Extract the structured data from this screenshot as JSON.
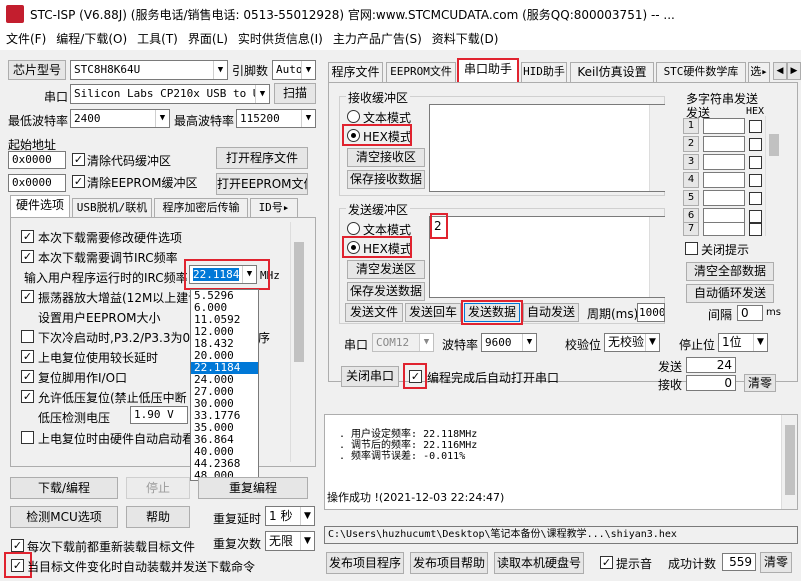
{
  "title": "STC-ISP (V6.88J) (服务电话/销售电话: 0513-55012928) 官网:www.STCMCUDATA.com  (服务QQ:800003751) -- ...",
  "menu": [
    "文件(F)",
    "编程/下载(O)",
    "工具(T)",
    "界面(L)",
    "实时供货信息(I)",
    "主力产品广告(S)",
    "资料下载(D)"
  ],
  "left": {
    "chip_label": "芯片型号",
    "chip_value": "STC8H8K64U",
    "pins_label": "引脚数",
    "pins_value": "Auto",
    "port_label": "串口",
    "port_value": "Silicon Labs CP210x USB to UA",
    "scan": "扫描",
    "min_baud_label": "最低波特率",
    "min_baud": "2400",
    "max_baud_label": "最高波特率",
    "max_baud": "115200",
    "start_addr_label": "起始地址",
    "addr1": "0x0000",
    "clear_code": "清除代码缓冲区",
    "open_prog": "打开程序文件",
    "addr2": "0x0000",
    "clear_eeprom": "清除EEPROM缓冲区",
    "open_eeprom": "打开EEPROM文件",
    "tabs": [
      "硬件选项",
      "USB脱机/联机",
      "程序加密后传输",
      "ID号▸"
    ],
    "opts": [
      "本次下载需要修改硬件选项",
      "本次下载需要调节IRC频率",
      "输入用户程序运行时的IRC频率",
      "振荡器放大增益(12M以上建议",
      "设置用户EEPROM大小",
      "下次冷启动时,P3.2/P3.3为0/0",
      "上电复位使用较长延时",
      "复位脚用作I/O口",
      "允许低压复位(禁止低压中断",
      "低压检测电压",
      "上电复位时由硬件自动启动看"
    ],
    "irc_value": "22.1184",
    "irc_unit": "MHz",
    "lv_value": "1.90 V",
    "opt_tail": "序",
    "freq_list": [
      "5.5296",
      "6.000",
      "11.0592",
      "12.000",
      "18.432",
      "20.000",
      "22.1184",
      "24.000",
      "27.000",
      "30.000",
      "33.1776",
      "35.000",
      "36.864",
      "40.000",
      "44.2368",
      "48.000"
    ],
    "download": "下载/编程",
    "stop": "停止",
    "reprogram": "重复编程",
    "detect": "检测MCU选项",
    "help": "帮助",
    "delay_label": "重复延时",
    "delay_value": "1 秒",
    "count_label": "重复次数",
    "count_value": "无限",
    "reload": "每次下载前都重新装载目标文件",
    "auto_reload": "当目标文件变化时自动装载并发送下载命令"
  },
  "right": {
    "tabs": [
      "程序文件",
      "EEPROM文件",
      "串口助手",
      "HID助手",
      "Keil仿真设置",
      "STC硬件数学库",
      "选▸"
    ],
    "rx_group": "接收缓冲区",
    "text_mode": "文本模式",
    "hex_mode": "HEX模式",
    "clear_rx": "清空接收区",
    "save_rx": "保存接收数据",
    "tx_group": "发送缓冲区",
    "clear_tx": "清空发送区",
    "save_tx": "保存发送数据",
    "tx_value": "2",
    "send_file": "发送文件",
    "send_return": "发送回车",
    "send_data": "发送数据",
    "auto_send": "自动发送",
    "period_label": "周期(ms)",
    "period": "1000",
    "multi_title": "多字符串发送",
    "col_send": "发送",
    "col_hex": "HEX",
    "multi_rows": [
      "1",
      "2",
      "3",
      "4",
      "5",
      "6",
      "7"
    ],
    "close_hint": "关闭提示",
    "clear_all": "清空全部数据",
    "auto_loop": "自动循环发送",
    "interval_label": "间隔",
    "interval": "0",
    "interval_unit": "ms",
    "serial_label": "串口",
    "serial_value": "COM12",
    "baud_label": "波特率",
    "baud_value": "9600",
    "parity_label": "校验位",
    "parity_value": "无校验",
    "stop_label": "停止位",
    "stop_value": "1位",
    "close_port": "关闭串口",
    "auto_open": "编程完成后自动打开串口",
    "send_label": "发送",
    "send_count": "24",
    "recv_label": "接收",
    "recv_count": "0",
    "clear_count": "清零",
    "log": [
      ". 用户设定频率: 22.118MHz",
      ". 调节后的频率: 22.116MHz",
      ". 频率调节误差: -0.011%"
    ],
    "log_ok": "操作成功 !(2021-12-03 22:24:47)",
    "path": "C:\\Users\\huzhucumt\\Desktop\\笔记本备份\\课程教学...\\shiyan3.hex",
    "publish": "发布项目程序",
    "publish_help": "发布项目帮助",
    "read_disk": "读取本机硬盘号",
    "sound": "提示音",
    "success_label": "成功计数",
    "success_count": "559",
    "clear_success": "清零"
  }
}
